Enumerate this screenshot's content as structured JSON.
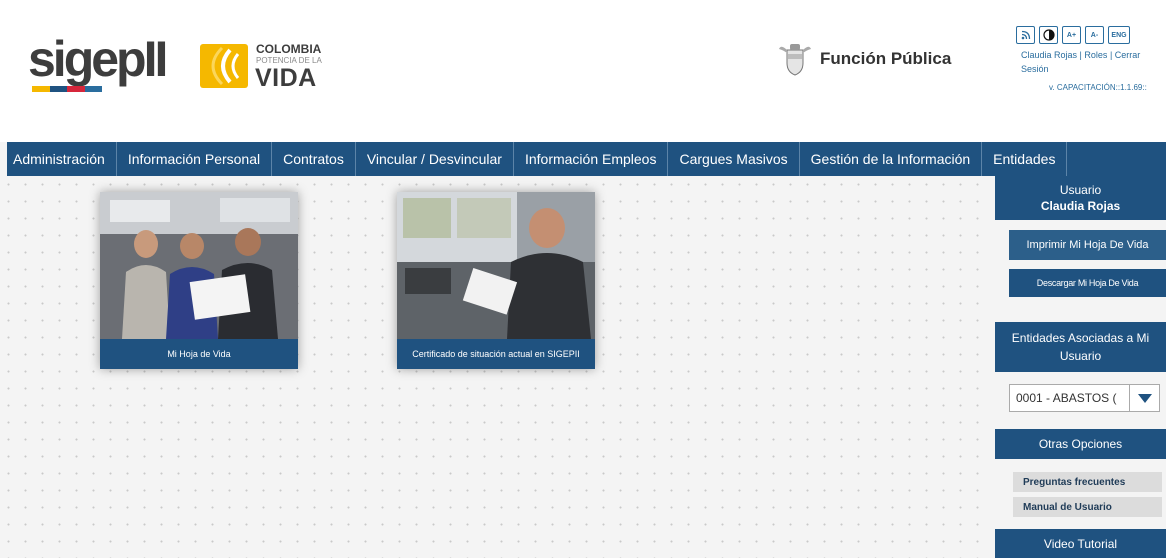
{
  "header": {
    "logo_sigep": "sigepII",
    "logo_colombia_line1": "COLOMBIA",
    "logo_colombia_line2": "POTENCIA DE LA",
    "logo_colombia_line3": "VIDA",
    "funcion_publica": "Función Pública",
    "tools": {
      "rss": "rss-icon",
      "contrast": "contrast-icon",
      "increase": "A+",
      "decrease": "A-",
      "language": "ENG"
    },
    "user_name_link": "Claudia Rojas",
    "roles_link": "Roles",
    "logout_link": "Cerrar Sesión",
    "separator": "|",
    "version": "v. CAPACITACIÓN::1.1.69::"
  },
  "menu": [
    "Administración",
    "Información Personal",
    "Contratos",
    "Vincular / Desvincular",
    "Información Empleos",
    "Cargues Masivos",
    "Gestión de la Información",
    "Entidades"
  ],
  "cards": [
    {
      "caption": "Mi Hoja de Vida"
    },
    {
      "caption": "Certificado de situación actual en SIGEPII"
    }
  ],
  "sidebar": {
    "user_label": "Usuario",
    "user_name": "Claudia Rojas",
    "print_cv": "Imprimir Mi Hoja De Vida",
    "download_cv": "Descargar Mi Hoja De Vida",
    "entities_title": "Entidades Asociadas a Mi Usuario",
    "entity_selected": "0001 - ABASTOS (",
    "other_options": "Otras Opciones",
    "faq": "Preguntas frecuentes",
    "manual": "Manual de Usuario",
    "video": "Video Tutorial"
  },
  "colors": {
    "primary": "#1f5280",
    "background": "#f4f4f4",
    "link": "#2a6d9e",
    "logo_yellow": "#f5b800"
  }
}
